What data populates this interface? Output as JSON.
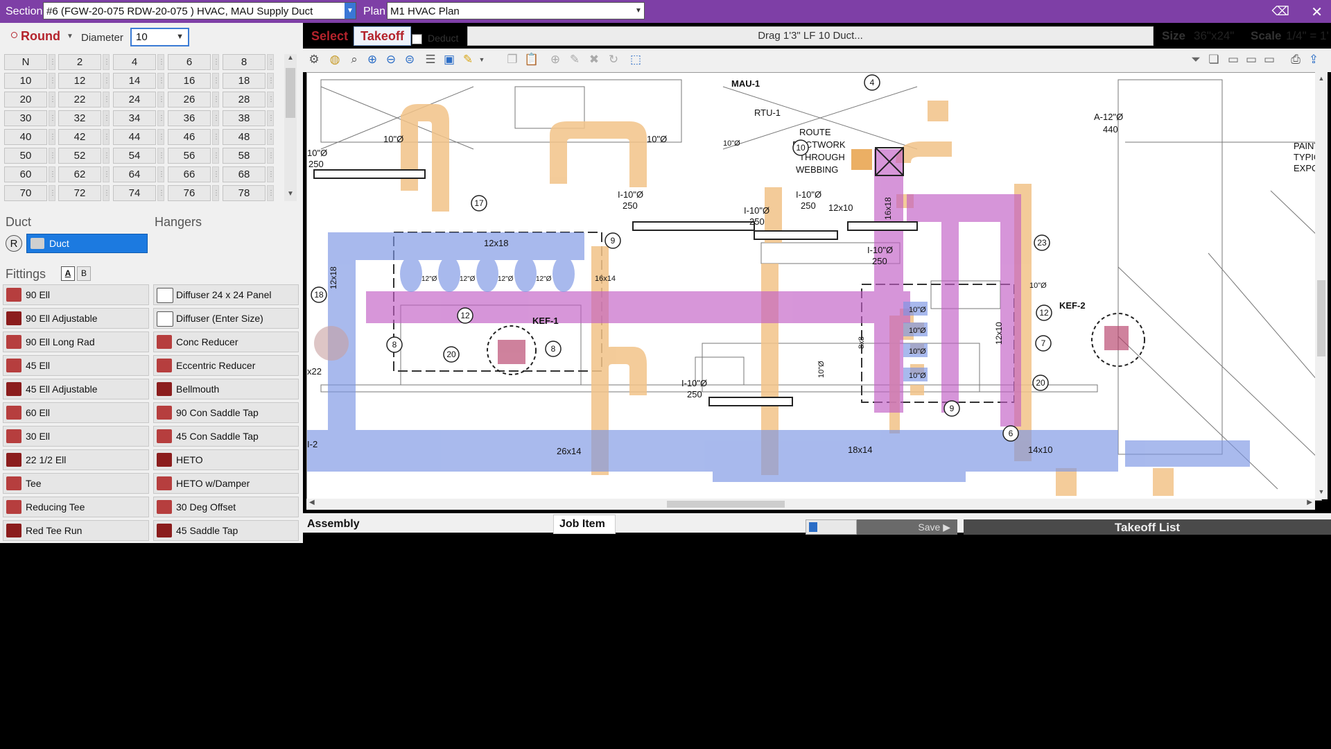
{
  "topbar": {
    "section_label": "Section",
    "section_value": "#6 (FGW-20-075 RDW-20-075 ) HVAC, MAU Supply Duct",
    "plan_label": "Plan",
    "plan_value": "M1   HVAC Plan",
    "back_icon": "⌫",
    "close_icon": "✕"
  },
  "shape": {
    "label": "Round",
    "diameter_label": "Diameter",
    "diameter_value": "10"
  },
  "sizes": [
    "N",
    "2",
    "4",
    "6",
    "8",
    "10",
    "12",
    "14",
    "16",
    "18",
    "20",
    "22",
    "24",
    "26",
    "28",
    "30",
    "32",
    "34",
    "36",
    "38",
    "40",
    "42",
    "44",
    "46",
    "48",
    "50",
    "52",
    "54",
    "56",
    "58",
    "60",
    "62",
    "64",
    "66",
    "68",
    "70",
    "72",
    "74",
    "76",
    "78"
  ],
  "duct_section": {
    "title": "Duct",
    "hangers_title": "Hangers",
    "r_label": "R",
    "item": "Duct"
  },
  "fittings": {
    "title": "Fittings",
    "tab_a": "A",
    "tab_b": "B",
    "left": [
      "90 Ell",
      "90 Ell Adjustable",
      "90 Ell Long Rad",
      "45 Ell",
      "45 Ell Adjustable",
      "60 Ell",
      "30 Ell",
      "22 1/2 Ell",
      "Tee",
      "Reducing Tee",
      "Red Tee Run"
    ],
    "right": [
      "Diffuser 24 x 24 Panel",
      "Diffuser (Enter Size)",
      "Conc Reducer",
      "Eccentric Reducer",
      "Bellmouth",
      "90 Con Saddle Tap",
      "45 Con Saddle Tap",
      "HETO",
      "HETO w/Damper",
      "30 Deg Offset",
      "45 Saddle Tap"
    ]
  },
  "toolbar": {
    "select_label": "Select",
    "takeoff_label": "Takeoff",
    "deduct_label": "Deduct",
    "status": "Drag 1'3\" LF 10 Duct...",
    "size_label": "Size",
    "size_value": "36\"x24\"",
    "scale_label": "Scale",
    "scale_value": "1/4\" = 1'"
  },
  "drawing": {
    "labels": {
      "mau1": "MAU-1",
      "rtu1": "RTU-1",
      "route": "ROUTE",
      "ductwork": "DUCTWORK",
      "through": "THROUGH",
      "webbing": "WEBBING",
      "a12": "A-12\"Ø",
      "a12cfm": "440",
      "paint1": "PAINT",
      "paint2": "TYPIC",
      "paint3": "EXPO",
      "d10a": "10\"Ø",
      "d10b": "10\"Ø",
      "i10a": "I-10\"Ø",
      "cfm250a": "250",
      "i10b": "I-10\"Ø",
      "cfm250b": "250",
      "i10c": "I-10\"Ø",
      "cfm250c": "250",
      "i10d": "I-10\"Ø",
      "cfm250d": "250",
      "i10e": "I-10\"Ø",
      "cfm250e": "250",
      "left10": "10\"Ø",
      "left250": "250",
      "dim12x18": "12x18",
      "dim12x10a": "12x10",
      "dim16x18": "16x18",
      "dim12x10b": "12x10",
      "dim12x18v": "12x18",
      "dim26x14": "26x14",
      "dim18x14": "18x14",
      "dim14x10": "14x10",
      "dim8x8": "8x8",
      "dim10v": "10\"Ø",
      "dim10va": "10\"Ø",
      "dim10vb": "10\"Ø",
      "dim14": "16x14",
      "dim12a": "12\"Ø",
      "dim12b": "12\"Ø",
      "dim12c": "12\"Ø",
      "dim12d": "12\"Ø",
      "kef1": "KEF-1",
      "kef2": "KEF-2",
      "x22": "x22",
      "i2": "I-2",
      "c4": "4",
      "c10": "10",
      "c17": "17",
      "c9a": "9",
      "c18": "18",
      "c12a": "12",
      "c8a": "8",
      "c8b": "8",
      "c20a": "20",
      "c23": "23",
      "c12b": "12",
      "c7": "7",
      "c20b": "20",
      "c9b": "9",
      "c6": "6",
      "r10a": "10\"Ø",
      "r10b": "10\"Ø",
      "r10c": "10\"Ø",
      "r10d": "10\"Ø"
    }
  },
  "bottom": {
    "assembly_tab": "Assembly",
    "jobitem_tab": "Job Item",
    "save_label": "Save ▶",
    "takeoff_list": "Takeoff List"
  }
}
